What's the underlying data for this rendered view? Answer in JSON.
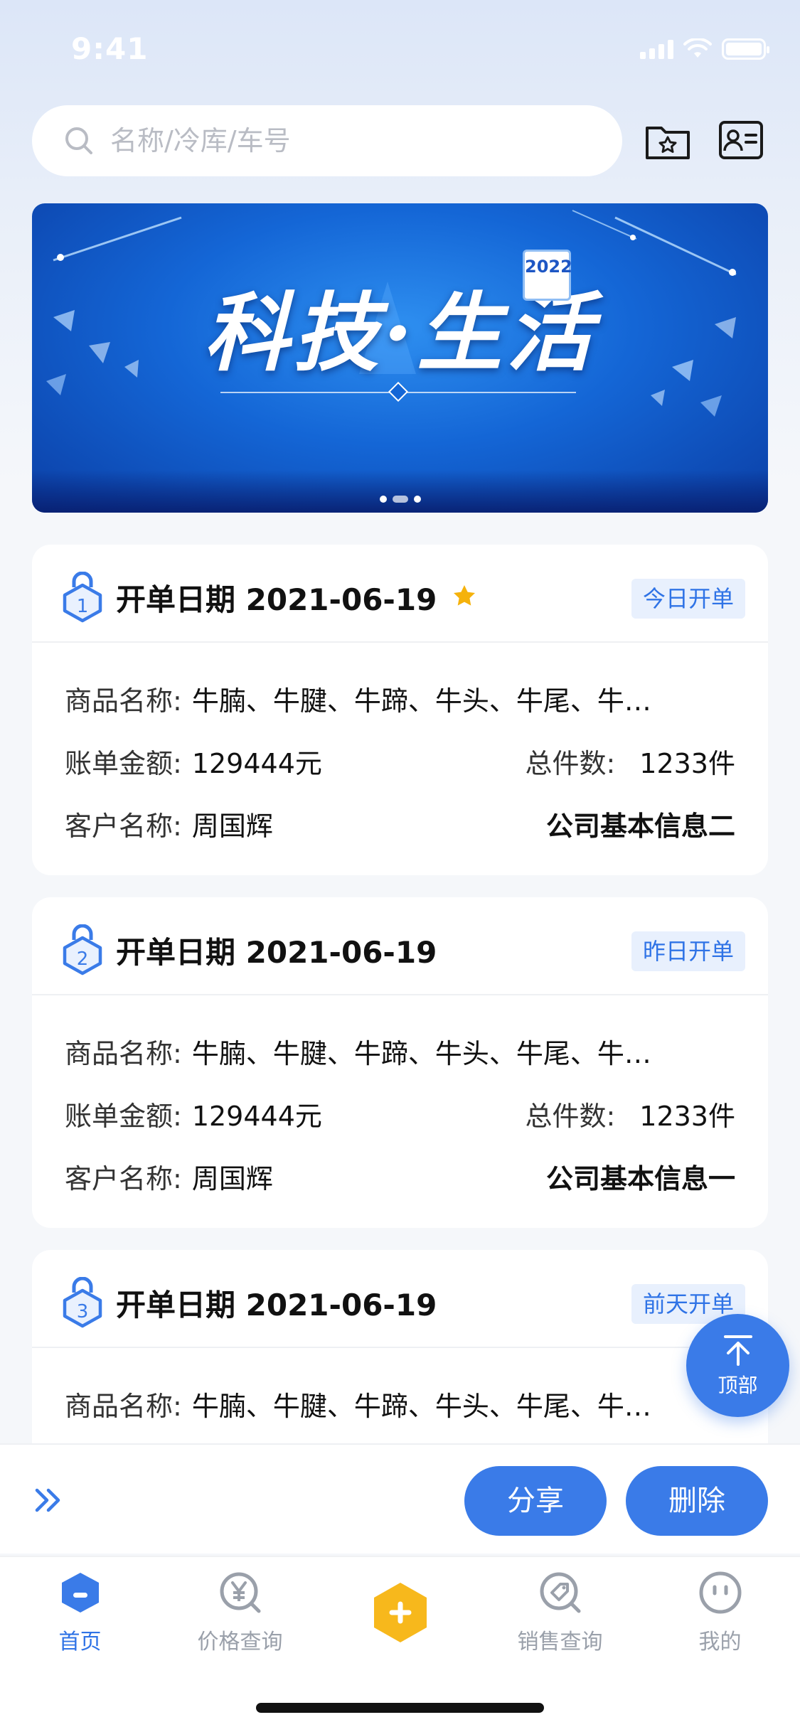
{
  "status_bar": {
    "time": "9:41"
  },
  "search": {
    "placeholder": "名称/冷库/车号"
  },
  "banner": {
    "title": "科技·生活",
    "year": "2022"
  },
  "cards": [
    {
      "badge_number": "1",
      "date_label": "开单日期",
      "date": "2021-06-19",
      "starred": true,
      "tag": "今日开单",
      "product_label": "商品名称:",
      "product": "牛腩、牛腱、牛蹄、牛头、牛尾、牛…",
      "amount_label": "账单金额:",
      "amount": "129444元",
      "count_label": "总件数:",
      "count": "1233件",
      "customer_label": "客户名称:",
      "customer": "周国辉",
      "company": "公司基本信息二"
    },
    {
      "badge_number": "2",
      "date_label": "开单日期",
      "date": "2021-06-19",
      "starred": false,
      "tag": "昨日开单",
      "product_label": "商品名称:",
      "product": "牛腩、牛腱、牛蹄、牛头、牛尾、牛…",
      "amount_label": "账单金额:",
      "amount": "129444元",
      "count_label": "总件数:",
      "count": "1233件",
      "customer_label": "客户名称:",
      "customer": "周国辉",
      "company": "公司基本信息一"
    },
    {
      "badge_number": "3",
      "date_label": "开单日期",
      "date": "2021-06-19",
      "starred": false,
      "tag": "前天开单",
      "product_label": "商品名称:",
      "product": "牛腩、牛腱、牛蹄、牛头、牛尾、牛…"
    }
  ],
  "to_top": {
    "label": "顶部"
  },
  "actions": {
    "share": "分享",
    "delete": "删除"
  },
  "tabs": [
    {
      "label": "首页",
      "icon": "home-icon",
      "active": true
    },
    {
      "label": "价格查询",
      "icon": "yen-search-icon",
      "active": false
    },
    {
      "label": "",
      "icon": "plus-hexagon-icon",
      "active": false
    },
    {
      "label": "销售查询",
      "icon": "tag-search-icon",
      "active": false
    },
    {
      "label": "我的",
      "icon": "profile-face-icon",
      "active": false
    }
  ],
  "colors": {
    "accent": "#3a7be8",
    "tag_bg": "#e8f0fd",
    "star": "#f5b20c",
    "center_button": "#f7b81c"
  }
}
